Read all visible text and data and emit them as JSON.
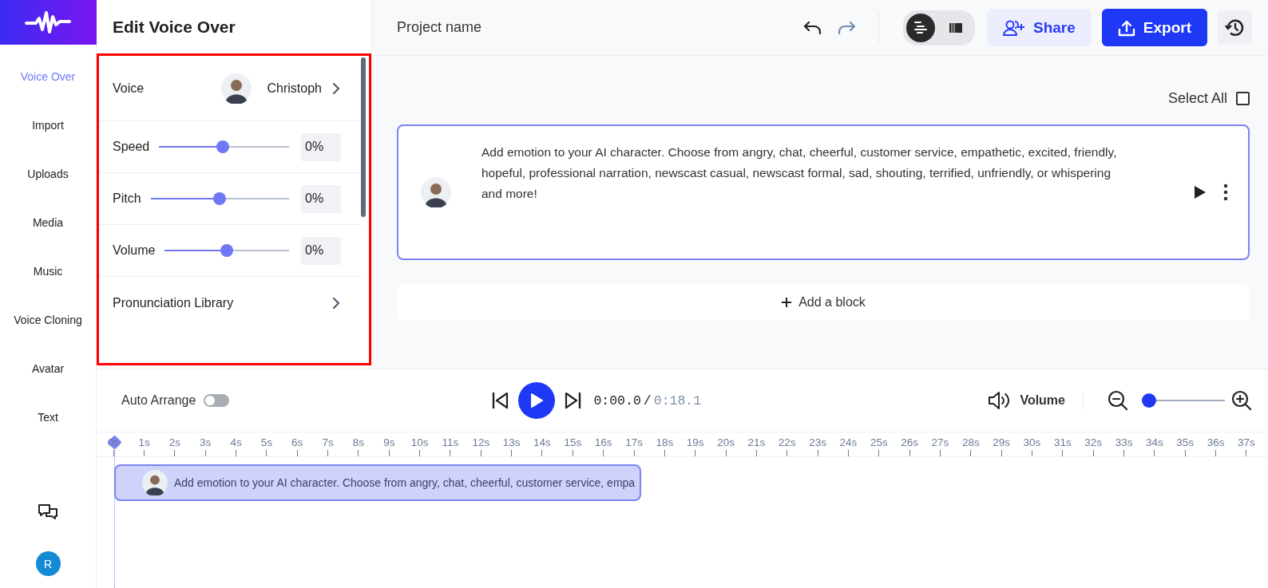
{
  "nav": {
    "items": [
      {
        "label": "Voice Over",
        "selected": true
      },
      {
        "label": "Import",
        "selected": false
      },
      {
        "label": "Uploads",
        "selected": false
      },
      {
        "label": "Media",
        "selected": false
      },
      {
        "label": "Music",
        "selected": false
      },
      {
        "label": "Voice Cloning",
        "selected": false
      },
      {
        "label": "Avatar",
        "selected": false
      },
      {
        "label": "Text",
        "selected": false
      }
    ],
    "user_initial": "R"
  },
  "panel": {
    "title": "Edit Voice Over",
    "rows": [
      {
        "kind": "voice",
        "label": "Voice",
        "value": "Christoph"
      },
      {
        "kind": "slider",
        "label": "Speed",
        "level": 0.49,
        "reading": "0%"
      },
      {
        "kind": "slider",
        "label": "Pitch",
        "level": 0.5,
        "reading": "0%"
      },
      {
        "kind": "slider",
        "label": "Volume",
        "level": 0.5,
        "reading": "0%"
      },
      {
        "kind": "link",
        "label": "Pronunciation Library"
      }
    ]
  },
  "topbar": {
    "project_name": "Project name",
    "view_modes": [
      {
        "kind": "list",
        "selected": true
      },
      {
        "kind": "film",
        "selected": false
      }
    ],
    "buttons": [
      {
        "kind": "share",
        "label": "Share"
      },
      {
        "kind": "export",
        "label": "Export"
      }
    ]
  },
  "editor": {
    "select_all": {
      "label": "Select All",
      "checked": false
    },
    "blocks": [
      {
        "text": "Add emotion to your AI character. Choose from angry, chat, cheerful, customer service, empathetic, excited, friendly, hopeful, professional narration, newscast casual, newscast formal, sad, shouting, terrified, unfriendly, or whispering and more!",
        "selected": true
      }
    ],
    "add_block": "Add a block"
  },
  "timeline": {
    "auto_arrange": {
      "label": "Auto Arrange",
      "on": false
    },
    "time_current": "0:00.0",
    "time_separator": "/",
    "time_total": "0:18.1",
    "volume_label": "Volume",
    "zoom": {
      "level": 0
    },
    "ruler": [
      "0s",
      "1s",
      "2s",
      "3s",
      "4s",
      "5s",
      "6s",
      "7s",
      "8s",
      "9s",
      "10s",
      "11s",
      "12s",
      "13s",
      "14s",
      "15s",
      "16s",
      "17s",
      "18s",
      "19s",
      "20s",
      "21s",
      "22s",
      "23s",
      "24s",
      "25s",
      "26s",
      "27s",
      "28s",
      "29s",
      "30s",
      "31s",
      "32s",
      "33s",
      "34s",
      "35s",
      "36s",
      "37s"
    ],
    "clips": [
      {
        "text": "Add emotion to your AI character. Choose from angry, chat, cheerful, customer service, empa"
      }
    ]
  }
}
